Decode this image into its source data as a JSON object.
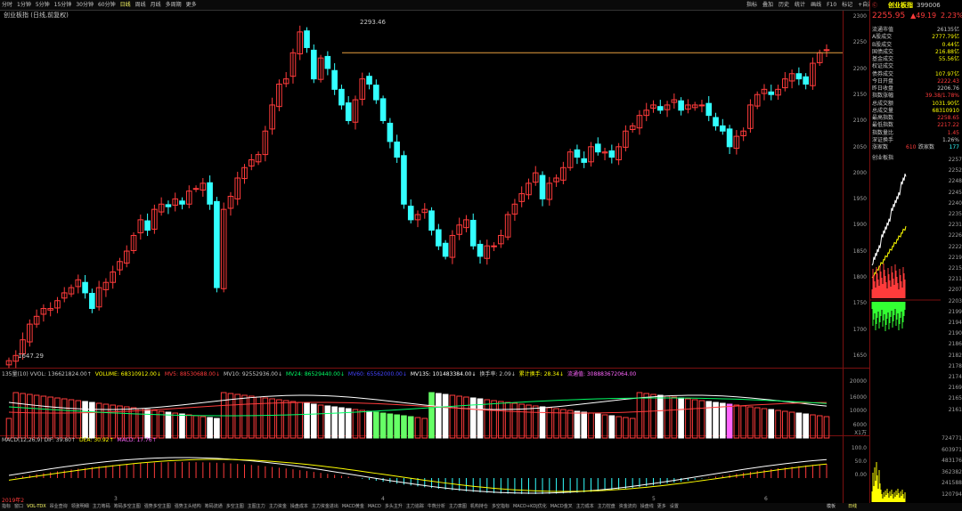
{
  "colors": {
    "up": "#ff3b3b",
    "down": "#33ffff",
    "bg": "#000000",
    "grid": "#7a1010",
    "ref_line": "#e8a040",
    "ma5": "#ffffff",
    "ma10": "#ffff00",
    "ma24": "#ff66ff",
    "ma135": "#00ff66"
  },
  "top_tabs": [
    "分时",
    "1分钟",
    "5分钟",
    "15分钟",
    "30分钟",
    "60分钟",
    "日线",
    "周线",
    "月线",
    "多周期",
    "更多"
  ],
  "top_tabs_active": 6,
  "top_right_tools": [
    "指标",
    "叠加",
    "历史",
    "统计",
    "画线",
    "F10",
    "标记",
    "+自选",
    "返回"
  ],
  "subtitle": "创业板指 (日线,前复权)",
  "price_axis": [
    "2300",
    "2250",
    "2200",
    "2150",
    "2100",
    "2050",
    "2000",
    "1950",
    "1900",
    "1850",
    "1800",
    "1750",
    "1700",
    "1650"
  ],
  "high_label": "2293.46",
  "low_label": "1647.29",
  "indicator_line": [
    {
      "text": "135量(10) VVOL: 136621824.00↑",
      "color": "#c8c8c8"
    },
    {
      "text": "VOLUME: 68310912.00↓",
      "color": "#ffff00"
    },
    {
      "text": "MV5: 88530688.00↓",
      "color": "#ff3b3b"
    },
    {
      "text": "MV10: 92552936.00↓",
      "color": "#c8c8c8"
    },
    {
      "text": "MV24: 86529440.00↓",
      "color": "#00ff66"
    },
    {
      "text": "MV60: 65562000.00↓",
      "color": "#4444ff"
    },
    {
      "text": "MV135: 101483384.00↓",
      "color": "#ffffff"
    },
    {
      "text": "换手率: 2.09↓",
      "color": "#c8c8c8"
    },
    {
      "text": "累计换手: 28.34↓",
      "color": "#ffff00"
    },
    {
      "text": "流通值: 308883672064.00",
      "color": "#ff66ff"
    }
  ],
  "volume_axis": [
    "20000",
    "16000",
    "10000",
    "6000",
    "X1万"
  ],
  "macd_line": [
    {
      "text": "MACD(12,26,9) DIF: 39.80↑",
      "color": "#c8c8c8"
    },
    {
      "text": "DEA: 30.92↑",
      "color": "#ffff00"
    },
    {
      "text": "MACD: 17.76↑",
      "color": "#ff66ff"
    }
  ],
  "macd_axis": [
    "100.0",
    "50.0",
    "0.00"
  ],
  "time_axis": [
    "2019年2",
    "3",
    "4",
    "5",
    "6"
  ],
  "bottom_tabs": [
    "指标",
    "窗口",
    "VOL-TDX",
    "昂业查询",
    "领涨明细",
    "主力筹码",
    "筹码多空主图",
    "强势多空主图",
    "强势主头结构",
    "筹码流通",
    "多空主图",
    "主图主力",
    "主力资金",
    "操盘成本",
    "主力资金进出",
    "MACD黄金",
    "MACD",
    "多头主升",
    "主力追踪",
    "牛熊分析",
    "主力意图",
    "机构持仓",
    "多空指标",
    "MACD+KDJ优化",
    "MACD金叉",
    "主力成本",
    "主力控盘",
    "资金流向",
    "操盘线",
    "更多",
    "设置"
  ],
  "bottom_tabs_active": 2,
  "bottom_right": [
    "模板",
    "日线"
  ],
  "panel": {
    "name": "创业板指",
    "code": "399006",
    "price": "2255.95",
    "change": "▲49.19",
    "pct": "2.23%",
    "stats": [
      {
        "label": "流通市值",
        "value": "26135亿",
        "color": "#c8c8c8"
      },
      {
        "label": "A股成交",
        "value": "2777.79亿",
        "color": "#ffff00"
      },
      {
        "label": "B股成交",
        "value": "0.44亿",
        "color": "#ffff00"
      },
      {
        "label": "国债成交",
        "value": "216.88亿",
        "color": "#ffff00"
      },
      {
        "label": "基金成交",
        "value": "55.56亿",
        "color": "#ffff00"
      },
      {
        "label": "权证成交",
        "value": "",
        "color": "#ffff00"
      },
      {
        "label": "债券成交",
        "value": "107.97亿",
        "color": "#ffff00"
      },
      {
        "label": "今日开盘",
        "value": "2222.43",
        "color": "#ff3b3b"
      },
      {
        "label": "昨日收盘",
        "value": "2206.76",
        "color": "#c8c8c8"
      },
      {
        "label": "指数涨幅",
        "value": "39.38/1.78%",
        "color": "#ff3b3b"
      },
      {
        "label": "总成交额",
        "value": "1031.90亿",
        "color": "#ffff00"
      },
      {
        "label": "总成交量",
        "value": "68310910",
        "color": "#ffff00"
      },
      {
        "label": "最高指数",
        "value": "2258.65",
        "color": "#ff3b3b"
      },
      {
        "label": "最低指数",
        "value": "2217.22",
        "color": "#ff3b3b"
      },
      {
        "label": "指数量比",
        "value": "1.45",
        "color": "#ff3b3b"
      },
      {
        "label": "深证换手",
        "value": "1.26%",
        "color": "#c8c8c8"
      }
    ],
    "rise_label": "涨家数",
    "rise": "610",
    "fall_label": "跌家数",
    "fall": "177",
    "mini_title": "创业板指",
    "intraday_axis": [
      "2257",
      "2252",
      "2248",
      "2245",
      "2240",
      "2235",
      "2231",
      "2226",
      "2222",
      "2219",
      "2215",
      "2211",
      "2207",
      "2203",
      "2199",
      "2194",
      "2190",
      "2186",
      "2182",
      "2178",
      "2174",
      "2169",
      "2165",
      "2161"
    ],
    "intraday_vol_axis": [
      "724771",
      "603971",
      "483176",
      "362382",
      "241588",
      "120794"
    ]
  }
}
